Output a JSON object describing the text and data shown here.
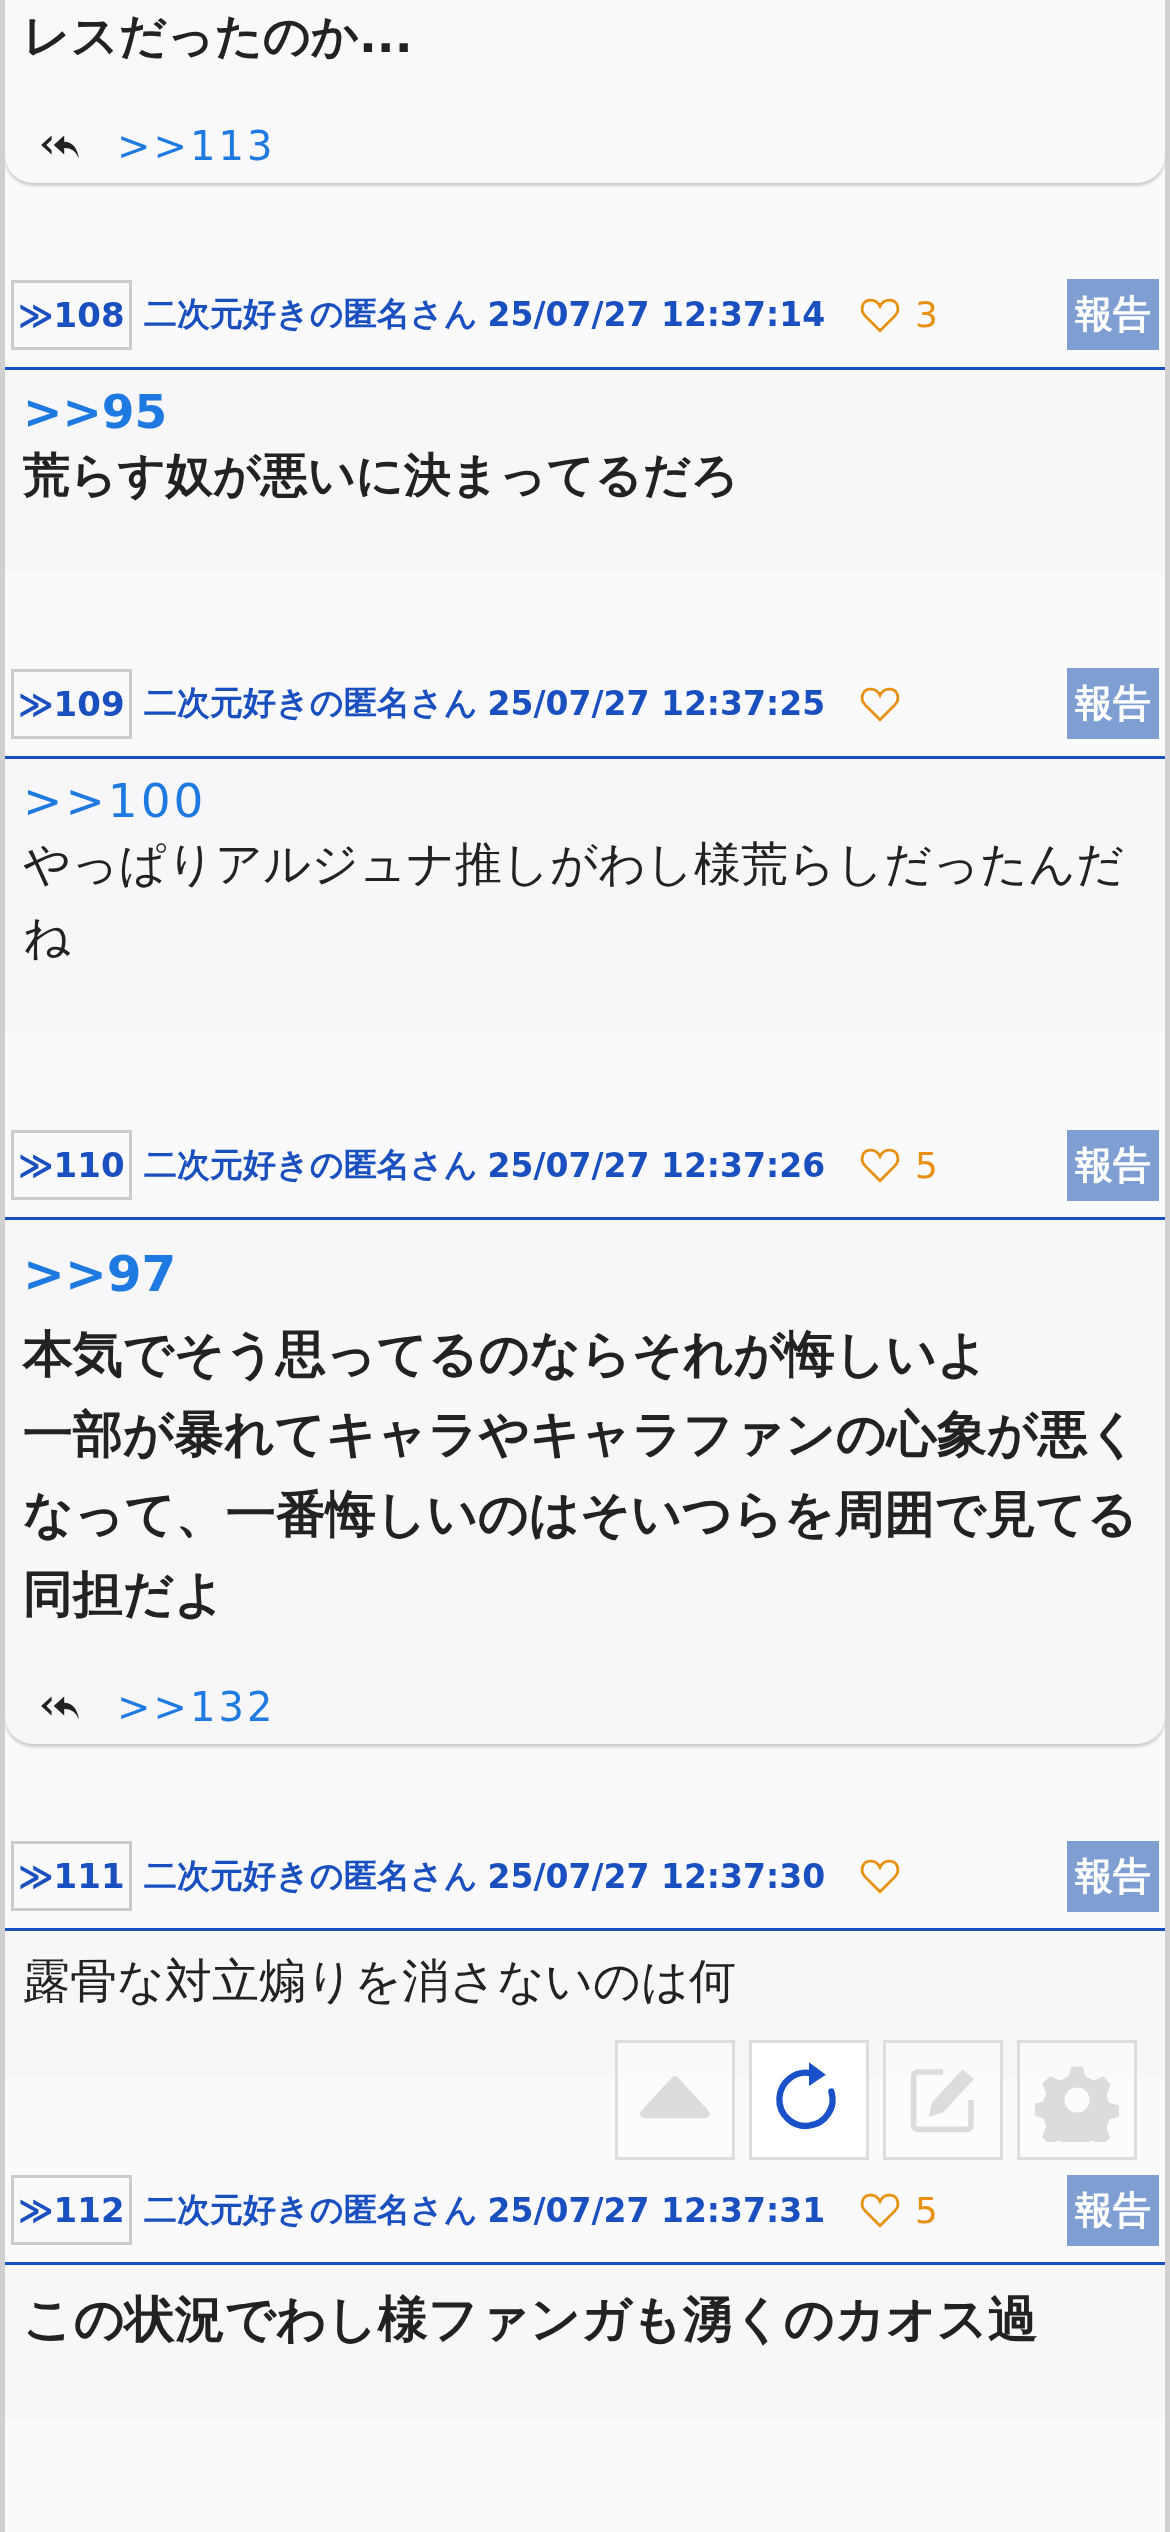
{
  "top_card": {
    "text": "レスだったのか...",
    "replies": [
      ">>113"
    ]
  },
  "posts": [
    {
      "number": "≫108",
      "author": "二次元好きの匿名さん",
      "date": "25/07/27 12:37:14",
      "likes": "3",
      "report": "報告",
      "quote": ">>95",
      "lines": [
        "荒らす奴が悪いに決まってるだろ"
      ],
      "kind": "bold"
    },
    {
      "number": "≫109",
      "author": "二次元好きの匿名さん",
      "date": "25/07/27 12:37:25",
      "report": "報告",
      "quote": ">>100",
      "lines": [
        "やっぱりアルジュナ推しがわし様荒らしだったんだね"
      ],
      "kind": "plain"
    },
    {
      "number": "≫110",
      "author": "二次元好きの匿名さん",
      "date": "25/07/27 12:37:26",
      "likes": "5",
      "report": "報告",
      "quote": ">>97",
      "lines": [
        "本気でそう思ってるのならそれが悔しいよ",
        "一部が暴れてキャラやキャラファンの心象が悪くなって、一番悔しいのはそいつらを周囲で見てる同担だよ"
      ],
      "kind": "large",
      "replies": [
        ">>132"
      ]
    },
    {
      "number": "≫111",
      "author": "二次元好きの匿名さん",
      "date": "25/07/27 12:37:30",
      "report": "報告",
      "lines": [
        "露骨な対立煽りを消さないのは何"
      ],
      "kind": "plain"
    },
    {
      "number": "≫112",
      "author": "二次元好きの匿名さん",
      "date": "25/07/27 12:37:31",
      "likes": "5",
      "report": "報告",
      "lines": [
        "この状況でわし様ファンガも湧くのカオス過"
      ],
      "kind": "large"
    }
  ],
  "float_buttons": [
    {
      "kind": "up",
      "disabled": true
    },
    {
      "kind": "refresh",
      "disabled": false
    },
    {
      "kind": "edit",
      "disabled": true
    },
    {
      "kind": "settings",
      "disabled": true
    }
  ]
}
